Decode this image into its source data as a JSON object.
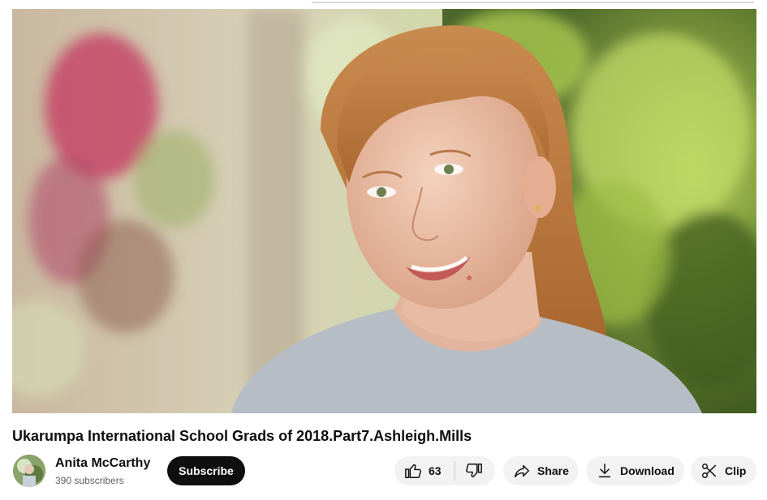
{
  "video": {
    "title": "Ukarumpa International School Grads of 2018.Part7.Ashleigh.Mills"
  },
  "channel": {
    "name": "Anita McCarthy",
    "subscribers": "390 subscribers",
    "subscribe_label": "Subscribe"
  },
  "actions": {
    "like_count": "63",
    "share_label": "Share",
    "download_label": "Download",
    "clip_label": "Clip"
  },
  "icons": {
    "like": "thumbs-up-icon",
    "dislike": "thumbs-down-icon",
    "share": "share-arrow-icon",
    "download": "download-icon",
    "clip": "scissors-icon"
  },
  "colors": {
    "subscribe_bg": "#0f0f0f",
    "pill_bg": "#f2f2f2",
    "secondary_text": "#606060"
  }
}
